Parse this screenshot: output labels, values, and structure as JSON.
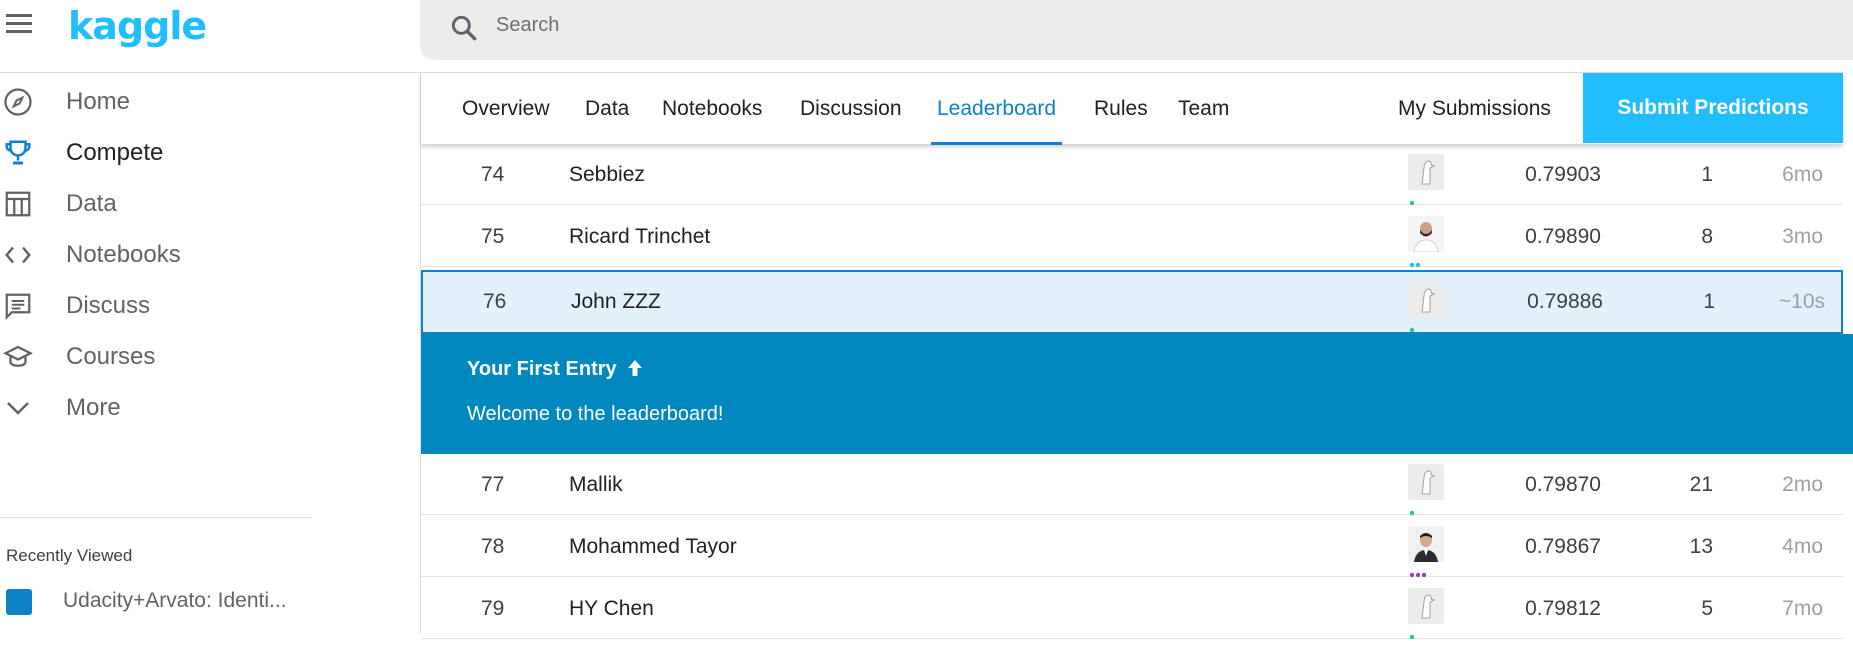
{
  "header": {
    "logo": "kaggle",
    "search_placeholder": "Search"
  },
  "sidebar": {
    "items": [
      {
        "label": "Home",
        "icon": "compass-icon",
        "active": false
      },
      {
        "label": "Compete",
        "icon": "trophy-icon",
        "active": true
      },
      {
        "label": "Data",
        "icon": "table-icon",
        "active": false
      },
      {
        "label": "Notebooks",
        "icon": "code-icon",
        "active": false
      },
      {
        "label": "Discuss",
        "icon": "comment-icon",
        "active": false
      },
      {
        "label": "Courses",
        "icon": "graduation-cap-icon",
        "active": false
      },
      {
        "label": "More",
        "icon": "chevron-down-icon",
        "active": false
      }
    ],
    "recent_title": "Recently Viewed",
    "recent_items": [
      {
        "label": "Udacity+Arvato: Identi...",
        "color": "#0d82c6"
      }
    ]
  },
  "tabs": {
    "items": [
      "Overview",
      "Data",
      "Notebooks",
      "Discussion",
      "Leaderboard",
      "Rules",
      "Team"
    ],
    "active": "Leaderboard",
    "my_submissions": "My Submissions",
    "submit": "Submit Predictions"
  },
  "leaderboard": {
    "rows": [
      {
        "rank": "74",
        "name": "Sebbiez",
        "score": "0.79903",
        "entries": "1",
        "last": "6mo",
        "avatar": "default",
        "dot_color": "#20c997",
        "dot_count": 1
      },
      {
        "rank": "75",
        "name": "Ricard Trinchet",
        "score": "0.79890",
        "entries": "8",
        "last": "3mo",
        "avatar": "person",
        "dot_color": "#20beff",
        "dot_count": 2
      },
      {
        "rank": "76",
        "name": "John ZZZ",
        "score": "0.79886",
        "entries": "1",
        "last": "~10s",
        "avatar": "default",
        "dot_color": "#20c997",
        "dot_count": 1
      },
      {
        "rank": "77",
        "name": "Mallik",
        "score": "0.79870",
        "entries": "21",
        "last": "2mo",
        "avatar": "default",
        "dot_color": "#20c997",
        "dot_count": 1
      },
      {
        "rank": "78",
        "name": "Mohammed Tayor",
        "score": "0.79867",
        "entries": "13",
        "last": "4mo",
        "avatar": "person-dark",
        "dot_color": "#8e44ad",
        "dot_count": 3
      },
      {
        "rank": "79",
        "name": "HY Chen",
        "score": "0.79812",
        "entries": "5",
        "last": "7mo",
        "avatar": "default",
        "dot_color": "#20c997",
        "dot_count": 1
      }
    ],
    "banner": {
      "title": "Your First Entry",
      "title_icon": "arrow-up-icon",
      "subtitle": "Welcome to the leaderboard!"
    }
  },
  "colors": {
    "brand": "#20beff",
    "accent": "#0d82c6",
    "banner": "#0088bf",
    "highlight": "#e3f2fa"
  }
}
